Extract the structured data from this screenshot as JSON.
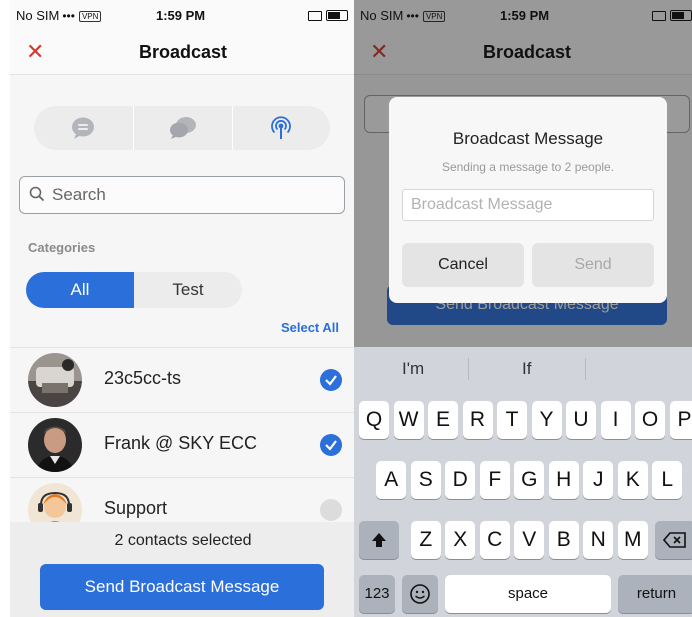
{
  "left": {
    "status": {
      "carrier": "No SIM",
      "vpn": "VPN",
      "time": "1:59 PM"
    },
    "nav": {
      "close_icon": "close-x-icon",
      "title": "Broadcast"
    },
    "segments": [
      "chat-bubble-icon",
      "group-chat-icon",
      "broadcast-icon"
    ],
    "search": {
      "placeholder": "Search"
    },
    "categories_label": "Categories",
    "category_tabs": {
      "all": "All",
      "test": "Test"
    },
    "select_all": "Select All",
    "contacts": [
      {
        "name": "23c5cc-ts",
        "selected": true
      },
      {
        "name": "Frank @ SKY ECC",
        "selected": true
      },
      {
        "name": "Support",
        "selected": false
      }
    ],
    "selected_count": "2 contacts selected",
    "send_button": "Send Broadcast Message",
    "accent_color": "#2b6fdb",
    "close_color": "#d23a2f"
  },
  "right": {
    "status": {
      "carrier": "No SIM",
      "vpn": "VPN",
      "time": "1:59 PM"
    },
    "nav": {
      "title": "Broadcast"
    },
    "dialog": {
      "title": "Broadcast Message",
      "subtitle": "Sending a message to 2 people.",
      "input_placeholder": "Broadcast Message",
      "cancel": "Cancel",
      "send": "Send"
    },
    "background_send_button": "Send Broadcast Message",
    "keyboard": {
      "predictions": [
        "I'm",
        "If"
      ],
      "row1": [
        "Q",
        "W",
        "E",
        "R",
        "T",
        "Y",
        "U",
        "I",
        "O",
        "P"
      ],
      "row2": [
        "A",
        "S",
        "D",
        "F",
        "G",
        "H",
        "J",
        "K",
        "L"
      ],
      "row3": [
        "Z",
        "X",
        "C",
        "V",
        "B",
        "N",
        "M"
      ],
      "numbers": "123",
      "space": "space",
      "return": "return"
    }
  }
}
